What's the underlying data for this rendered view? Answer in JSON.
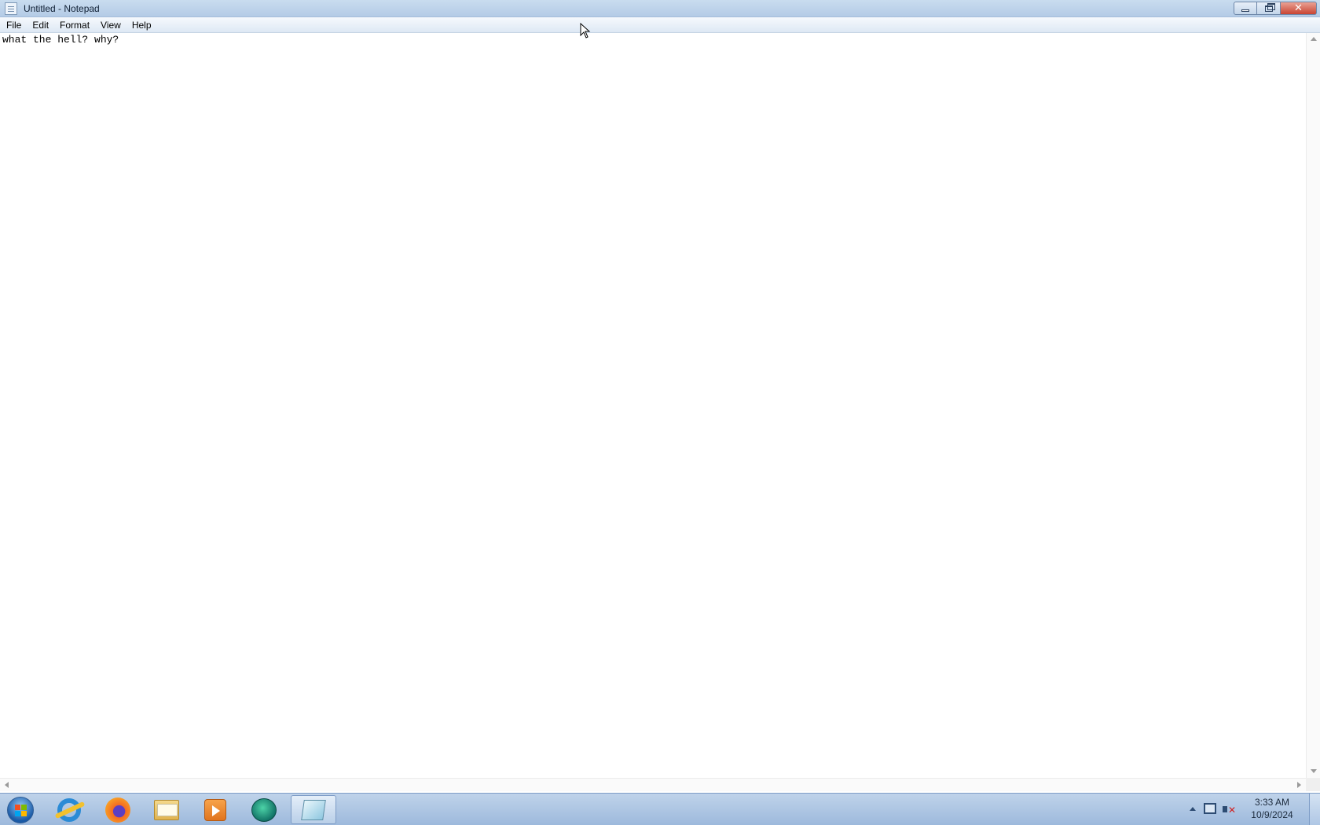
{
  "window": {
    "title": "Untitled - Notepad"
  },
  "menu": {
    "items": [
      "File",
      "Edit",
      "Format",
      "View",
      "Help"
    ]
  },
  "editor": {
    "content": "what the hell? why?"
  },
  "taskbar": {
    "pinned": [
      {
        "name": "internet-explorer",
        "icon": "ie-icon"
      },
      {
        "name": "firefox",
        "icon": "firefox-icon"
      },
      {
        "name": "file-explorer",
        "icon": "folder-icon"
      },
      {
        "name": "media-player",
        "icon": "media-player-icon"
      },
      {
        "name": "chat-app",
        "icon": "chat-icon"
      },
      {
        "name": "notepad",
        "icon": "notepad-icon",
        "active": true
      }
    ],
    "clock": {
      "time": "3:33 AM",
      "date": "10/9/2024"
    }
  },
  "colors": {
    "titlebar": "#c9dcef",
    "taskbar": "#bfd3ea",
    "close_button": "#c94533"
  }
}
